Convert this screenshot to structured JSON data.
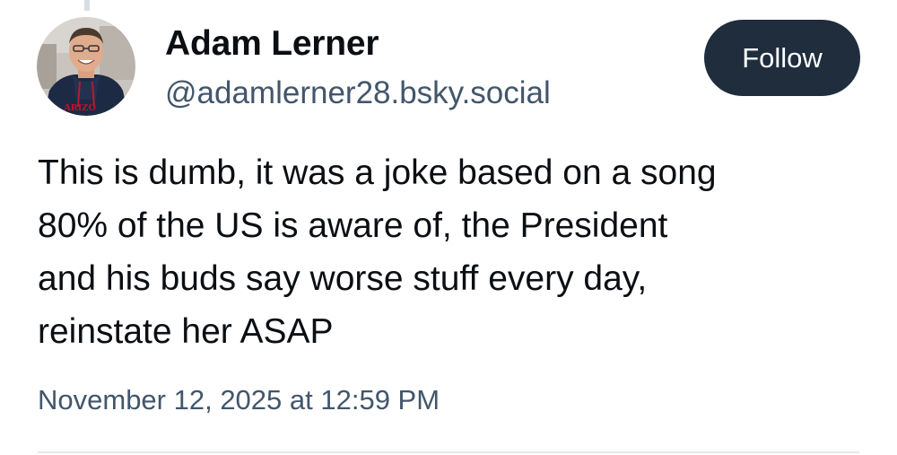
{
  "post": {
    "author": {
      "display_name": "Adam Lerner",
      "handle": "@adamlerner28.bsky.social",
      "avatar_icon": "profile-photo",
      "avatar_shirt_text": "ARIZO"
    },
    "follow_label": "Follow",
    "text_lines": [
      "This is dumb, it was a joke based on a song",
      "80% of the US is aware of, the President",
      "and his buds say worse stuff every day,",
      "reinstate her ASAP"
    ],
    "timestamp": "November 12, 2025 at 12:59 PM"
  },
  "colors": {
    "follow_button_bg": "#1f2d3d",
    "handle_text": "#42566b",
    "body_text": "#0b0f14"
  }
}
